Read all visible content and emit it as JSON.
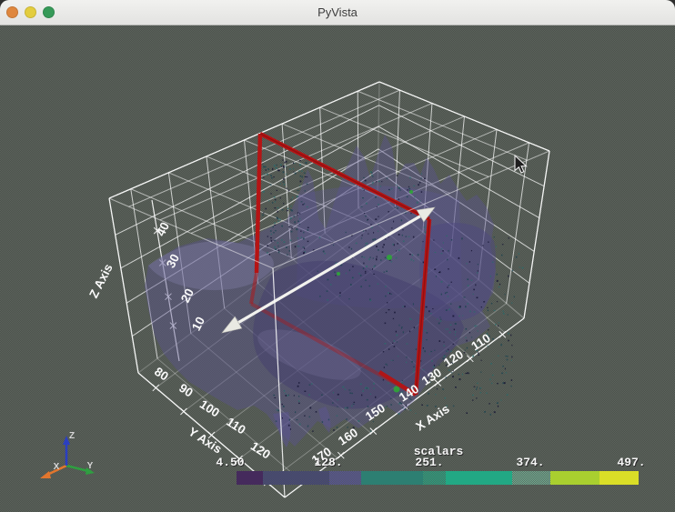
{
  "window": {
    "title": "PyVista",
    "controls": [
      {
        "name": "close",
        "color": "#df873e"
      },
      {
        "name": "minimize",
        "color": "#e3cd3e"
      },
      {
        "name": "zoom",
        "color": "#369a58"
      }
    ]
  },
  "scene": {
    "background_light": "#5c635c",
    "background_dark": "#4c524c",
    "grid_color": "#ffffff",
    "mesh_color": "#5b5492",
    "mesh_dark": "#433d6e",
    "mesh_light": "#8a85b2",
    "mesh_mid": "#4e4880",
    "plane_widget_color": "#b51414",
    "plane_widget_shadow": "#7e0c0c",
    "line_widget_color": "#f2f2ee",
    "cone_color": "#e9e9e3",
    "speckle_colors": [
      "#141432",
      "#1c4450",
      "#2a6a6a"
    ],
    "green_marker_color": "#2fa33a"
  },
  "axes": {
    "x": {
      "title": "X Axis",
      "ticks": [
        "170",
        "160",
        "150",
        "140",
        "130",
        "120",
        "110"
      ]
    },
    "y": {
      "title": "Y Axis",
      "ticks": [
        "80",
        "90",
        "100",
        "110",
        "120"
      ]
    },
    "z": {
      "title": "Z Axis",
      "ticks": [
        "10",
        "20",
        "30",
        "40"
      ]
    }
  },
  "colorbar": {
    "title": "scalars",
    "tick_labels": [
      "4.50",
      "128.",
      "251.",
      "374.",
      "497."
    ],
    "segments": [
      {
        "color": "#452a5c",
        "dither": false,
        "w": 6.5
      },
      {
        "color": "#3e3e7c",
        "dither": true,
        "w": 16.5
      },
      {
        "color": "#55519b",
        "dither": true,
        "w": 8.0
      },
      {
        "color": "#2d7f72",
        "dither": false,
        "w": 15.4
      },
      {
        "color": "#22a884",
        "dither": true,
        "w": 5.6
      },
      {
        "color": "#22a884",
        "dither": false,
        "w": 16.5
      },
      {
        "color": "#6fae92",
        "dither": true,
        "w": 9.5
      },
      {
        "color": "#a9cf2f",
        "dither": false,
        "w": 12.3
      },
      {
        "color": "#dade27",
        "dither": false,
        "w": 9.7
      }
    ]
  },
  "orientation_axes": {
    "x": {
      "label": "X",
      "color": "#e2762e"
    },
    "y": {
      "label": "Y",
      "color": "#2f9e41"
    },
    "z": {
      "label": "Z",
      "color": "#2b3fc0"
    }
  }
}
